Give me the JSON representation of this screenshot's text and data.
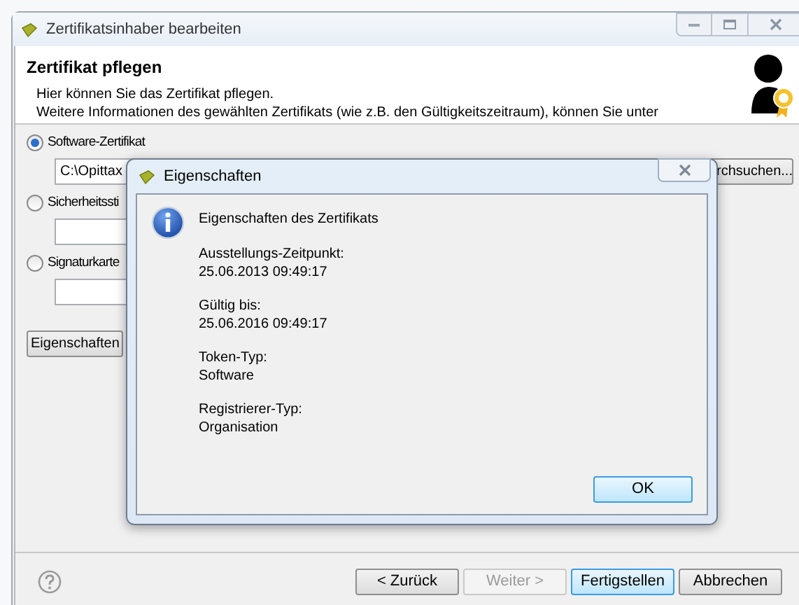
{
  "window": {
    "title": "Zertifikatsinhaber bearbeiten"
  },
  "header": {
    "title": "Zertifikat pflegen",
    "lines": [
      "Hier können Sie das Zertifikat pflegen.",
      "Weitere Informationen des gewählten Zertifikats (wie z.B. den Gültigkeitszeitraum), können Sie unter"
    ]
  },
  "options": [
    {
      "label": "Software-Zertifikat",
      "selected": true,
      "value": "C:\\Opittax",
      "button": "rchsuchen..."
    },
    {
      "label": "Sicherheitssti",
      "selected": false
    },
    {
      "label": "Signaturkarte",
      "selected": false
    }
  ],
  "properties_button": "Eigenschaften",
  "buttons": [
    {
      "label": "< Zurück",
      "disabled": false,
      "default": false
    },
    {
      "label": "Weiter >",
      "disabled": true,
      "default": false
    },
    {
      "label": "Fertigstellen",
      "disabled": false,
      "default": true
    },
    {
      "label": "Abbrechen",
      "disabled": false,
      "default": false
    }
  ],
  "dialog": {
    "title": "Eigenschaften",
    "heading": "Eigenschaften des Zertifikats",
    "fields": [
      {
        "label": "Ausstellungs-Zeitpunkt:",
        "value": "25.06.2013 09:49:17"
      },
      {
        "label": "Gültig bis:",
        "value": "25.06.2016 09:49:17"
      },
      {
        "label": "Token-Typ:",
        "value": "Software"
      },
      {
        "label": "Registrierer-Typ:",
        "value": "Organisation"
      }
    ],
    "ok_button": "OK"
  }
}
